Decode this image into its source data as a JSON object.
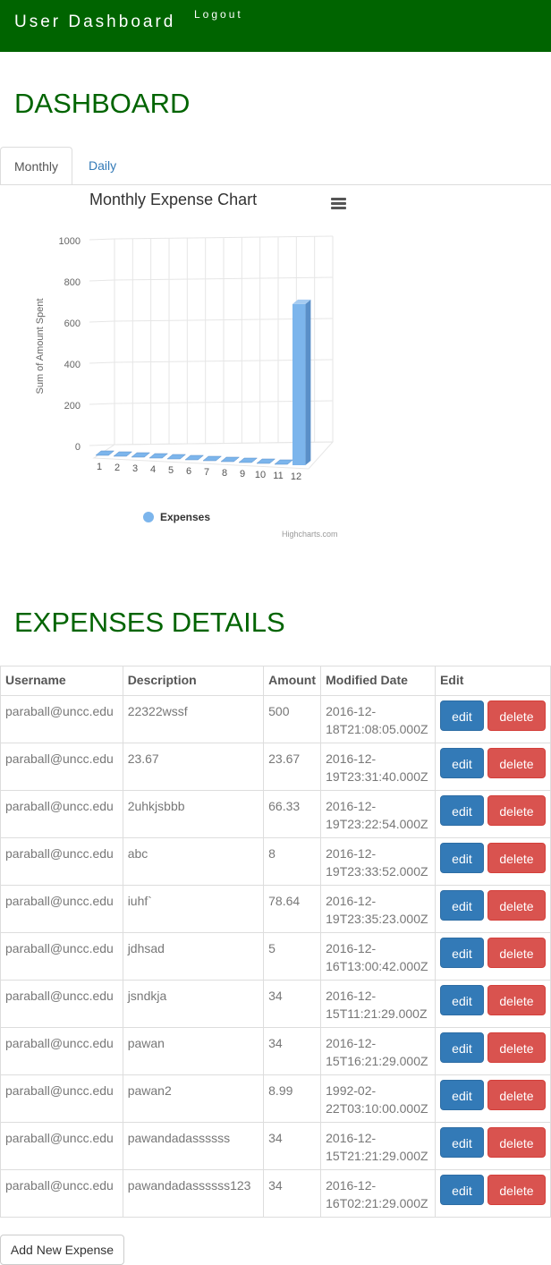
{
  "header": {
    "brand": "User Dashboard",
    "logout": "Logout"
  },
  "dashboard_title": "DASHBOARD",
  "tabs": [
    {
      "label": "Monthly"
    },
    {
      "label": "Daily"
    }
  ],
  "chart": {
    "menu_icon": "hamburger-menu-icon",
    "credits": "Highcharts.com",
    "bar_color": "#7cb5ec"
  },
  "chart_data": {
    "type": "bar",
    "title": "Monthly Expense Chart",
    "ylabel": "Sum of Amount Spent",
    "xlabel": "",
    "categories": [
      "1",
      "2",
      "3",
      "4",
      "5",
      "6",
      "7",
      "8",
      "9",
      "10",
      "11",
      "12"
    ],
    "series": [
      {
        "name": "Expenses",
        "values": [
          0,
          0,
          0,
          0,
          0,
          0,
          0,
          0,
          0,
          0,
          0,
          767.63
        ]
      }
    ],
    "ylim": [
      0,
      1000
    ],
    "yticks": [
      0,
      200,
      400,
      600,
      800,
      1000
    ],
    "grid": true,
    "legend": "bottom-center",
    "three_d": true
  },
  "expenses_title": "EXPENSES DETAILS",
  "table": {
    "headers": [
      "Username",
      "Description",
      "Amount",
      "Modified Date",
      "Edit"
    ],
    "rows": [
      {
        "username": "paraball@uncc.edu",
        "description": "22322wssf",
        "amount": "500",
        "date1": "2016-12-",
        "date2": "18T21:08:05.000Z"
      },
      {
        "username": "paraball@uncc.edu",
        "description": "23.67",
        "amount": "23.67",
        "date1": "2016-12-",
        "date2": "19T23:31:40.000Z"
      },
      {
        "username": "paraball@uncc.edu",
        "description": "2uhkjsbbb",
        "amount": "66.33",
        "date1": "2016-12-",
        "date2": "19T23:22:54.000Z"
      },
      {
        "username": "paraball@uncc.edu",
        "description": "abc",
        "amount": "8",
        "date1": "2016-12-",
        "date2": "19T23:33:52.000Z"
      },
      {
        "username": "paraball@uncc.edu",
        "description": "iuhf`",
        "amount": "78.64",
        "date1": "2016-12-",
        "date2": "19T23:35:23.000Z"
      },
      {
        "username": "paraball@uncc.edu",
        "description": "jdhsad",
        "amount": "5",
        "date1": "2016-12-",
        "date2": "16T13:00:42.000Z"
      },
      {
        "username": "paraball@uncc.edu",
        "description": "jsndkja",
        "amount": "34",
        "date1": "2016-12-",
        "date2": "15T11:21:29.000Z"
      },
      {
        "username": "paraball@uncc.edu",
        "description": "pawan",
        "amount": "34",
        "date1": "2016-12-",
        "date2": "15T16:21:29.000Z"
      },
      {
        "username": "paraball@uncc.edu",
        "description": "pawan2",
        "amount": "8.99",
        "date1": "1992-02-",
        "date2": "22T03:10:00.000Z"
      },
      {
        "username": "paraball@uncc.edu",
        "description": "pawandadassssss",
        "amount": "34",
        "date1": "2016-12-",
        "date2": "15T21:21:29.000Z"
      },
      {
        "username": "paraball@uncc.edu",
        "description": "pawandadassssss123",
        "amount": "34",
        "date1": "2016-12-",
        "date2": "16T02:21:29.000Z"
      }
    ],
    "edit_label": "edit",
    "delete_label": "delete"
  },
  "add_button": "Add New Expense",
  "colors": {
    "header_bg": "#006400",
    "heading": "#006400",
    "edit": "#337ab7",
    "delete": "#d9534f"
  }
}
